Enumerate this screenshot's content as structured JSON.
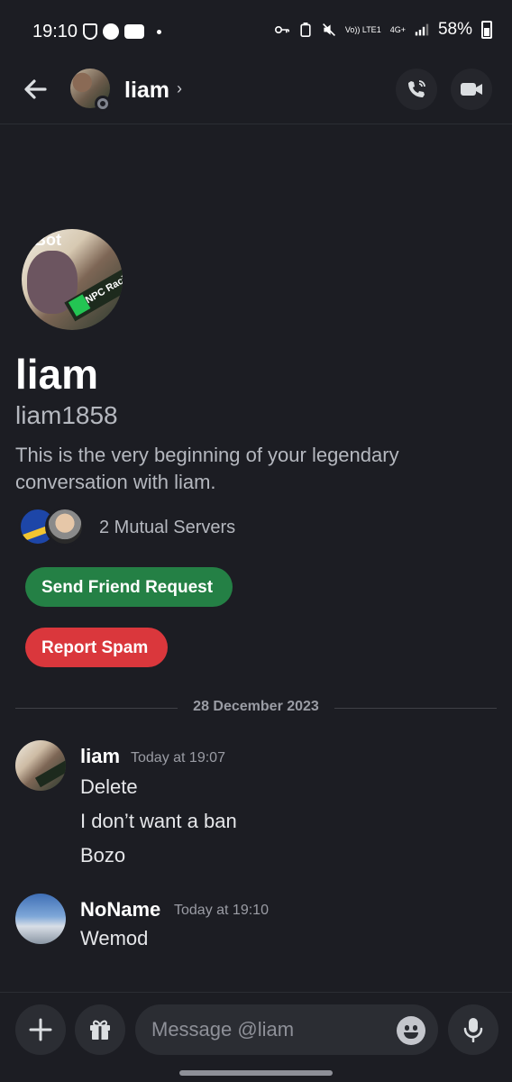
{
  "status_bar": {
    "time": "19:10",
    "volte": "Vo)) LTE1",
    "network": "4G+",
    "battery": "58%"
  },
  "header": {
    "name": "liam",
    "chevron": "›"
  },
  "intro": {
    "name": "liam",
    "handle": "liam1858",
    "text": "This is the very beginning of your legendary conversation with liam.",
    "mutual_servers": "2 Mutual Servers",
    "avatar_text_top": "Bot",
    "avatar_text_tag": "NPC Raci"
  },
  "buttons": {
    "friend_request": "Send Friend Request",
    "report_spam": "Report Spam"
  },
  "divider": {
    "date": "28 December 2023"
  },
  "messages": [
    {
      "author": "liam",
      "time": "Today at 19:07",
      "lines": [
        "Delete",
        "I don’t want a ban",
        "Bozo"
      ]
    },
    {
      "author": "NoName",
      "time": "Today at 19:10",
      "lines": [
        "Wemod"
      ]
    }
  ],
  "composer": {
    "placeholder": "Message @liam"
  },
  "colors": {
    "background": "#1c1d23",
    "green": "#248045",
    "red": "#da373c"
  }
}
